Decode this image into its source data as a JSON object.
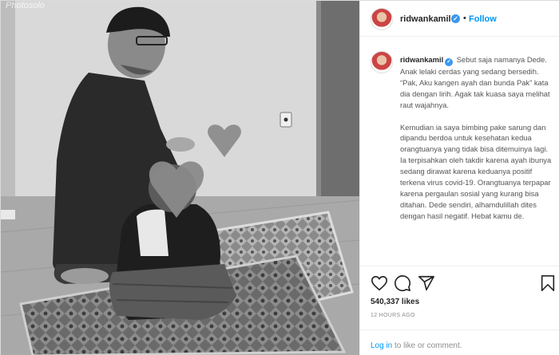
{
  "photo": {
    "watermark": "Photosolo",
    "alt": "Man and child praying on a prayer rug, black and white photo"
  },
  "header": {
    "username": "ridwankamil",
    "verified_icon": "verified-badge-icon",
    "separator": "•",
    "follow_label": "Follow"
  },
  "caption": {
    "username": "ridwankamil",
    "paragraph1": "Sebut saja namanya Dede. Anak lelaki cerdas yang sedang bersedih. “Pak, Aku kangen ayah dan bunda Pak” kata dia dengan lirih. Agak tak kuasa saya melihat raut wajahnya.",
    "paragraph2": "Kemudian ia saya bimbing pake sarung dan dipandu berdoa untuk kesehatan kedua orangtuanya yang tidak bisa ditemuinya lagi. Ia terpisahkan oleh takdir karena ayah ibunya sedang dirawat karena keduanya positif terkena virus covid-19. Orangtuanya terpapar karena pergaulan sosial yang kurang bisa ditahan. Dede sendiri, alhamdulillah dites dengan hasil negatif. Hebat kamu de."
  },
  "actions": {
    "icons": [
      "heart-icon",
      "comment-icon",
      "share-icon",
      "bookmark-icon"
    ],
    "likes": "540,337 likes",
    "time_ago": "12 HOURS AGO",
    "login_link": "Log in",
    "login_rest": " to like or comment."
  },
  "colors": {
    "accent": "#0095f6",
    "verified": "#3897f0",
    "border": "#dbdbdb"
  }
}
